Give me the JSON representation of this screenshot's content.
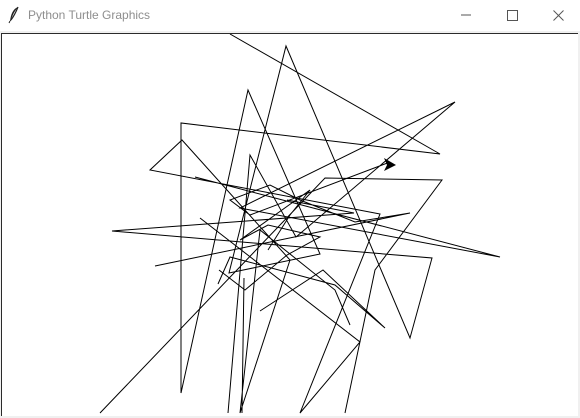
{
  "window": {
    "title": "Python Turtle Graphics",
    "app_icon": "feather-icon",
    "controls": {
      "minimize_icon": "minimize-icon",
      "maximize_icon": "maximize-icon",
      "close_icon": "close-icon"
    }
  },
  "canvas": {
    "background": "#ffffff",
    "pen_color": "#000000",
    "turtle_icon": "turtle-arrow-icon"
  }
}
